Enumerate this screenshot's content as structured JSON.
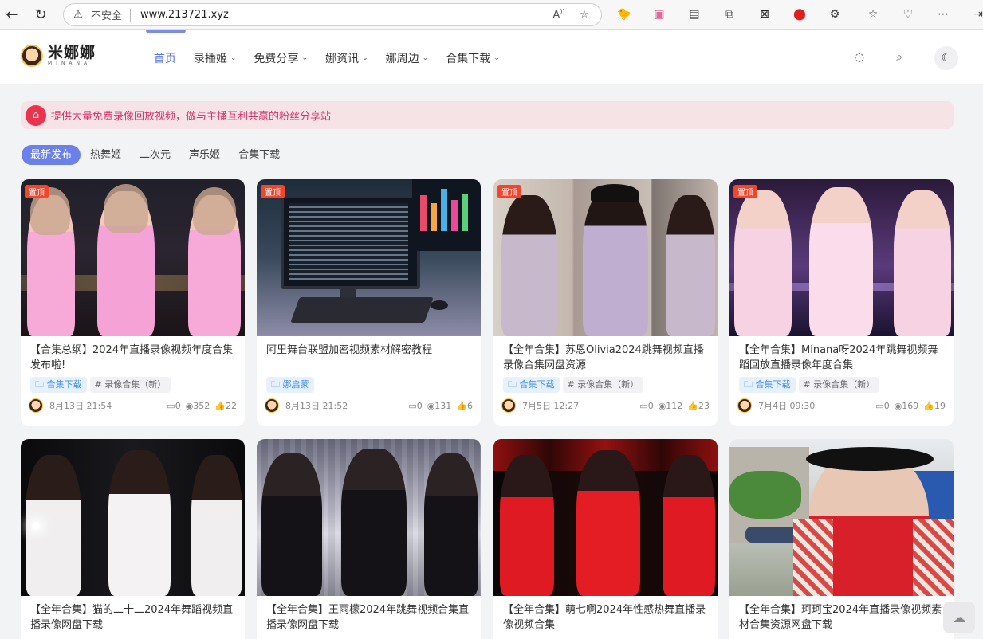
{
  "browser": {
    "insecure_label": "不安全",
    "url": "www.213721.xyz"
  },
  "site": {
    "logo_cn": "米娜娜",
    "logo_en": "MINANA",
    "nav": [
      {
        "label": "首页"
      },
      {
        "label": "录播姬"
      },
      {
        "label": "免费分享"
      },
      {
        "label": "娜资讯"
      },
      {
        "label": "娜周边"
      },
      {
        "label": "合集下载"
      }
    ]
  },
  "notice": "提供大量免费录像回放视频，做与主播互利共赢的粉丝分享站",
  "tabs": [
    "最新发布",
    "热舞姬",
    "二次元",
    "声乐姬",
    "合集下载"
  ],
  "pin_label": "置顶",
  "posts": [
    {
      "title": "【合集总纲】2024年直播录像视频年度合集发布啦!",
      "cat": "合集下载",
      "tag": "录像合集（新）",
      "date": "8月13日 21:54",
      "comments": "0",
      "views": "352",
      "likes": "22"
    },
    {
      "title": "阿里舞台联盟加密视频素材解密教程",
      "cat": "娜启蒙",
      "tag": "",
      "date": "8月13日 21:52",
      "comments": "0",
      "views": "131",
      "likes": "6"
    },
    {
      "title": "【全年合集】苏恩Olivia2024跳舞视频直播录像合集网盘资源",
      "cat": "合集下载",
      "tag": "录像合集（新）",
      "date": "7月5日 12:27",
      "comments": "0",
      "views": "112",
      "likes": "23"
    },
    {
      "title": "【全年合集】Minana呀2024年跳舞视频舞蹈回放直播录像年度合集",
      "cat": "合集下载",
      "tag": "录像合集（新）",
      "date": "7月4日 09:30",
      "comments": "0",
      "views": "169",
      "likes": "19"
    },
    {
      "title": "【全年合集】猫的二十二2024年舞蹈视频直播录像网盘下载"
    },
    {
      "title": "【全年合集】王雨檬2024年跳舞视频合集直播录像网盘下载"
    },
    {
      "title": "【全年合集】萌七啊2024年性感热舞直播录像视频合集"
    },
    {
      "title": "【全年合集】珂珂宝2024年直播录像视频素材合集资源网盘下载"
    }
  ]
}
